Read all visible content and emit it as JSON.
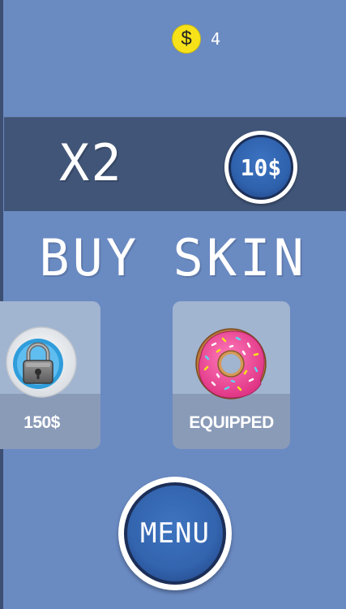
{
  "coins": {
    "icon": "dollar-coin-icon",
    "symbol": "$",
    "count": "4"
  },
  "multiplier": {
    "label": "X2",
    "price_label": "10$"
  },
  "buy_skin": {
    "title": "BUY SKIN"
  },
  "skins": [
    {
      "icon": "lock-icon",
      "label": "150$",
      "state": "locked"
    },
    {
      "icon": "donut-icon",
      "label": "EQUIPPED",
      "state": "equipped"
    }
  ],
  "menu": {
    "label": "MENU"
  },
  "colors": {
    "background": "#6a8ac2",
    "panel": "#415578",
    "button_blue": "#3364ae",
    "coin_yellow": "#f7e21a",
    "card_top": "#a1b4d0",
    "card_bottom": "#8a9bb8",
    "donut_icing": "#ee4d9b"
  }
}
